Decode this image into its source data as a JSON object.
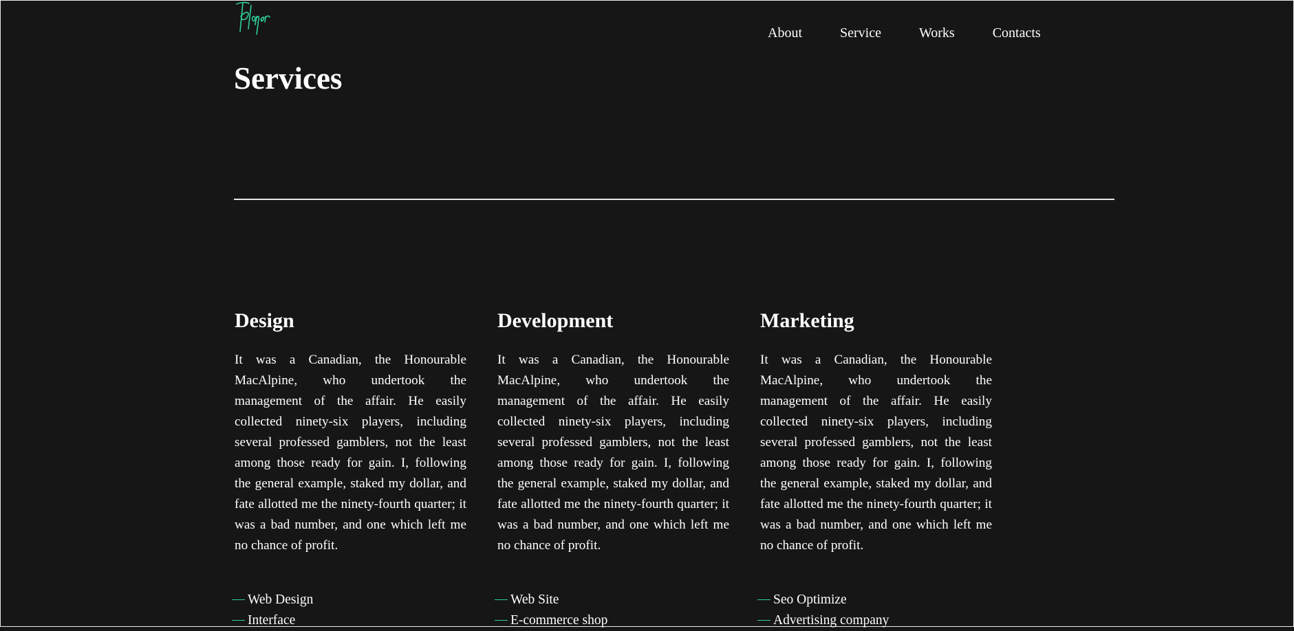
{
  "brand": {
    "logo_text": "Player",
    "accent_color": "#2fcf9a"
  },
  "nav": {
    "items": [
      "About",
      "Service",
      "Works",
      "Contacts"
    ]
  },
  "page": {
    "title": "Services"
  },
  "services": [
    {
      "title": "Design",
      "text": "It was a Canadian, the Honourable MacAlpine, who undertook the management of the affair. He easily collected ninety-six players, including several professed gamblers, not the least among those ready for gain. I, following the general example, staked my dollar, and fate allotted me the ninety-fourth quarter; it was a bad number, and one which left me no chance of profit.",
      "items": [
        "Web Design",
        "Interface"
      ]
    },
    {
      "title": "Development",
      "text": "It was a Canadian, the Honourable MacAlpine, who undertook the management of the affair. He easily collected ninety-six players, including several professed gamblers, not the least among those ready for gain. I, following the general example, staked my dollar, and fate allotted me the ninety-fourth quarter; it was a bad number, and one which left me no chance of profit.",
      "items": [
        "Web Site",
        "E-commerce shop"
      ]
    },
    {
      "title": "Marketing",
      "text": "It was a Canadian, the Honourable MacAlpine, who undertook the management of the affair. He easily collected ninety-six players, including several professed gamblers, not the least among those ready for gain. I, following the general example, staked my dollar, and fate allotted me the ninety-fourth quarter; it was a bad number, and one which left me no chance of profit.",
      "items": [
        "Seo Optimize",
        "Advertising company"
      ]
    }
  ]
}
